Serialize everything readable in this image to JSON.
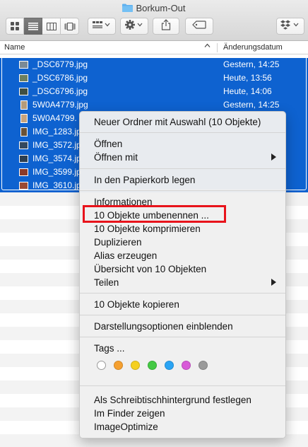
{
  "window": {
    "title": "Borkum-Out",
    "folder_icon": "folder-icon"
  },
  "toolbar": {
    "view_buttons": [
      {
        "icon": "icon-view-icon"
      },
      {
        "icon": "list-view-icon",
        "active": true
      },
      {
        "icon": "column-view-icon"
      },
      {
        "icon": "cover-flow-icon"
      }
    ],
    "group_icon": "arrange-icon",
    "action_icon": "gear-icon",
    "share_icon": "share-icon",
    "tag_icon": "tag-icon",
    "dropbox_icon": "dropbox-icon"
  },
  "columns": {
    "name": "Name",
    "date": "Änderungsdatum"
  },
  "files": [
    {
      "name": "_DSC6779.jpg",
      "date": "Gestern, 14:25"
    },
    {
      "name": "_DSC6786.jpg",
      "date": "Heute, 13:56"
    },
    {
      "name": "_DSC6796.jpg",
      "date": "Heute, 14:06"
    },
    {
      "name": "5W0A4779.jpg",
      "date": "Gestern, 14:25"
    },
    {
      "name": "5W0A4799.",
      "date": ""
    },
    {
      "name": "IMG_1283.jp",
      "date": ""
    },
    {
      "name": "IMG_3572.jp",
      "date": ""
    },
    {
      "name": "IMG_3574.jp",
      "date": ""
    },
    {
      "name": "IMG_3599.jp",
      "date": ""
    },
    {
      "name": "IMG_3610.jp",
      "date": ""
    }
  ],
  "context_menu": {
    "new_folder": "Neuer Ordner mit Auswahl (10 Objekte)",
    "open": "Öffnen",
    "open_with": "Öffnen mit",
    "trash": "In den Papierkorb legen",
    "info": "Informationen",
    "rename": "10 Objekte umbenennen ...",
    "compress": "10 Objekte komprimieren",
    "duplicate": "Duplizieren",
    "alias": "Alias erzeugen",
    "overview": "Übersicht von 10 Objekten",
    "share": "Teilen",
    "copy": "10 Objekte kopieren",
    "view_options": "Darstellungsoptionen einblenden",
    "tags": "Tags ...",
    "tag_colors": [
      "#ffffff",
      "#f5a030",
      "#f5d020",
      "#44c944",
      "#2aa4f4",
      "#d85ad8",
      "#9a9a9a"
    ],
    "desktop": "Als Schreibtischhintergrund festlegen",
    "finder": "Im Finder zeigen",
    "imageoptimize": "ImageOptimize"
  },
  "colors": {
    "selection": "#0e62d0",
    "highlight_box": "#e8131b"
  }
}
